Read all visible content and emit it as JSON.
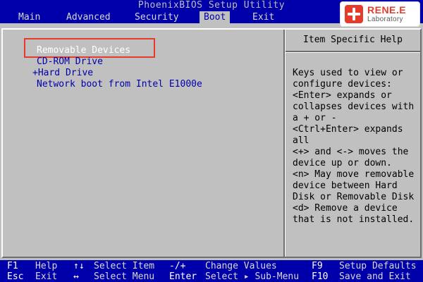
{
  "header": {
    "title": "PhoenixBIOS Setup Utility",
    "tabs": [
      {
        "label": "Main",
        "active": false
      },
      {
        "label": "Advanced",
        "active": false
      },
      {
        "label": "Security",
        "active": false
      },
      {
        "label": "Boot",
        "active": true
      },
      {
        "label": "Exit",
        "active": false
      }
    ]
  },
  "logo": {
    "name": "RENE.E",
    "sub": "Laboratory"
  },
  "boot_list": {
    "items": [
      {
        "label": "Removable Devices",
        "selected": true
      },
      {
        "label": "CD-ROM Drive",
        "selected": false
      },
      {
        "label": "+Hard Drive",
        "selected": false
      },
      {
        "label": "Network boot from Intel E1000e",
        "selected": false
      }
    ]
  },
  "help": {
    "title": "Item Specific Help",
    "lines": [
      "Keys used to view or",
      "configure devices:",
      "<Enter> expands or",
      "collapses devices with",
      "a + or -",
      "<Ctrl+Enter> expands",
      "all",
      "<+> and <-> moves the",
      "device up or down.",
      "<n> May move removable",
      "device between Hard",
      "Disk or Removable Disk",
      "<d> Remove a device",
      "that is not installed."
    ]
  },
  "footer": {
    "row1": [
      {
        "key": "F1",
        "desc": "Help"
      },
      {
        "key": "↑↓",
        "desc": "Select Item"
      },
      {
        "key": "-/+",
        "desc": "Change Values"
      },
      {
        "key": "F9",
        "desc": "Setup Defaults"
      }
    ],
    "row2": [
      {
        "key": "Esc",
        "desc": "Exit"
      },
      {
        "key": "↔",
        "desc": "Select Menu"
      },
      {
        "key": "Enter",
        "desc": "Select ▸ Sub-Menu"
      },
      {
        "key": "F10",
        "desc": "Save and Exit"
      }
    ]
  },
  "colors": {
    "bios_blue": "#0000aa",
    "bios_gray": "#c0c0c0",
    "highlight_red": "#e53b2c"
  }
}
